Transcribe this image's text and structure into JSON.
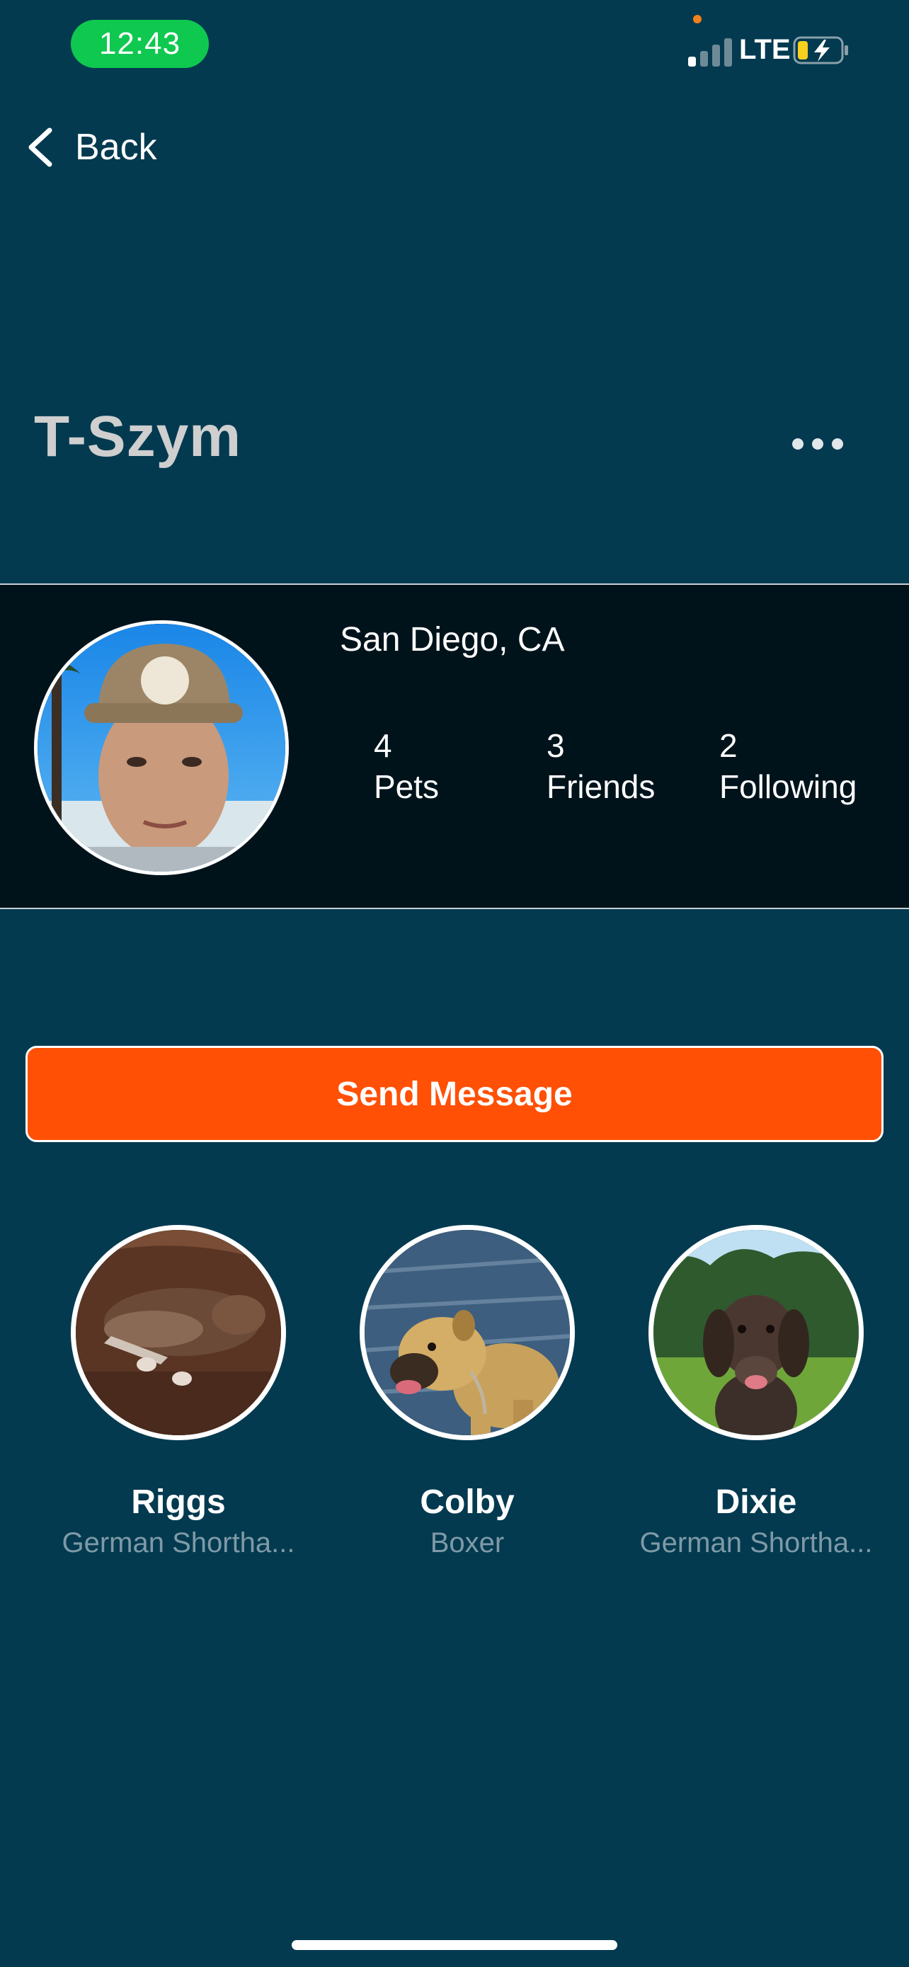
{
  "status_bar": {
    "time": "12:43",
    "network": "LTE",
    "time_pill_color": "#0fc84f",
    "battery_color": "#f7d11e"
  },
  "nav": {
    "back_label": "Back",
    "back_icon": "chevron-left-icon",
    "more_icon": "more-horizontal-icon"
  },
  "profile": {
    "username": "T-Szym",
    "location": "San Diego, CA",
    "stats": [
      {
        "value": "4",
        "label": "Pets"
      },
      {
        "value": "3",
        "label": "Friends"
      },
      {
        "value": "2",
        "label": "Following"
      }
    ]
  },
  "actions": {
    "send_message_label": "Send Message",
    "accent_color": "#ff5005"
  },
  "pets": [
    {
      "name": "Riggs",
      "breed": "German Shortha..."
    },
    {
      "name": "Colby",
      "breed": "Boxer"
    },
    {
      "name": "Dixie",
      "breed": "German Shortha..."
    }
  ],
  "colors": {
    "background": "#033a50",
    "profile_band": "#00131b",
    "muted_text": "#7e9aa6"
  }
}
